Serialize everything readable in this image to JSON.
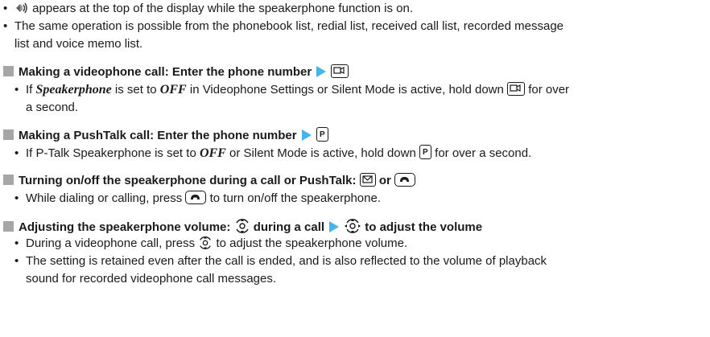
{
  "bullets_top": {
    "b1": "appears at the top of the display while the speakerphone function is on.",
    "b2_line1": "The same operation is possible from the phonebook list, redial list, received call list, recorded message",
    "b2_line2": "list and voice memo list."
  },
  "sections": {
    "video": {
      "heading": "Making a videophone call: Enter the phone number",
      "note_a": "If",
      "note_b": "Speakerphone",
      "note_c": "is set to",
      "note_d": "OFF",
      "note_e": "in Videophone Settings or Silent Mode is active, hold down",
      "note_f": "for over",
      "note_line2": "a second."
    },
    "pushtalk": {
      "heading": "Making a PushTalk call: Enter the phone number",
      "note_a": "If P-Talk Speakerphone is set to",
      "note_b": "OFF",
      "note_c": "or Silent Mode is active, hold down",
      "note_d": "for over a second."
    },
    "toggle": {
      "heading": "Turning on/off the speakerphone during a call or PushTalk:",
      "or": "or",
      "note_a": "While dialing or calling, press",
      "note_b": "to turn on/off the speakerphone."
    },
    "volume": {
      "heading_a": "Adjusting the speakerphone volume:",
      "heading_b": "during a call",
      "heading_c": "to adjust the volume",
      "note1_a": "During a videophone call, press",
      "note1_b": "to adjust the speakerphone volume.",
      "note2_line1": "The setting is retained even after the call is ended, and is also reflected to the volume of playback",
      "note2_line2": "sound for recorded videophone call messages."
    }
  },
  "icons": {
    "speaker_status": "speakerphone-status-icon",
    "videophone_key": "videophone-key-icon",
    "pushtalk_key": "pushtalk-key-icon",
    "mail_key": "mail-key-icon",
    "call_key": "call-key-icon",
    "updown_nav": "up-down-nav-key-icon",
    "multi_nav": "multi-direction-nav-key-icon"
  },
  "colors": {
    "arrow": "#45b4e9",
    "square": "#a6a6a6",
    "text": "#1a1a1a"
  }
}
